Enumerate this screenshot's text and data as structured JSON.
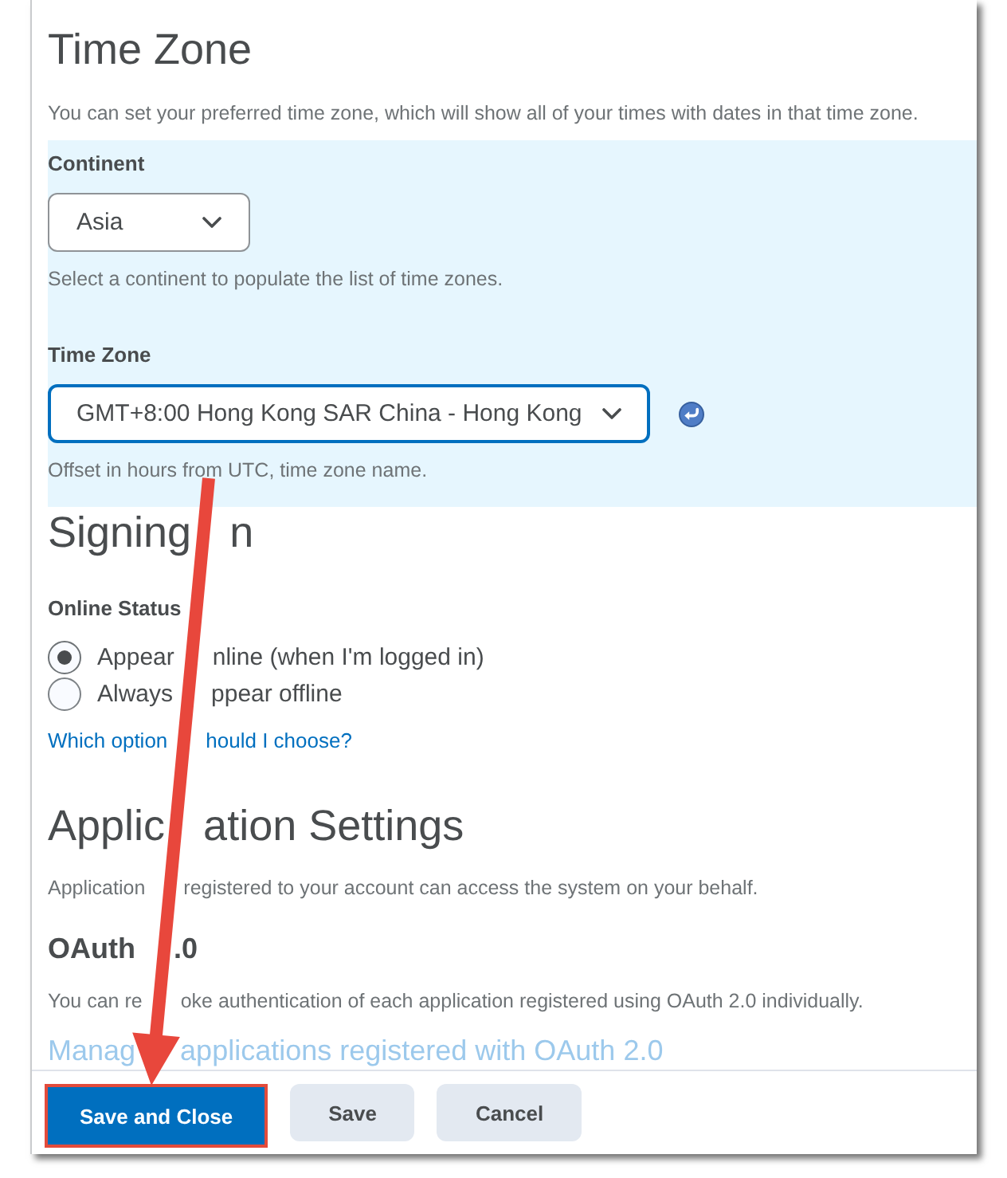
{
  "time_zone": {
    "title": "Time Zone",
    "description": "You can set your preferred time zone, which will show all of your times with dates in that time zone.",
    "continent": {
      "label": "Continent",
      "value": "Asia",
      "focused": false,
      "help": "Select a continent to populate the list of time zones."
    },
    "zone": {
      "label": "Time Zone",
      "value": "GMT+8:00 Hong Kong SAR China - Hong Kong",
      "focused": true,
      "help": "Offset in hours from UTC, time zone name."
    }
  },
  "signing_in": {
    "title": [
      "Signing",
      "n"
    ],
    "status_label": "Online Status",
    "options": [
      {
        "label": [
          "Appear",
          "nline (when I'm logged in)"
        ],
        "selected": true
      },
      {
        "label": [
          "Always",
          "ppear offline"
        ],
        "selected": false
      }
    ],
    "help_link": [
      "Which option",
      "hould I choose?"
    ]
  },
  "application_settings": {
    "title": [
      "Applic",
      "ation Settings"
    ],
    "description": [
      "Application",
      "registered to your account can access the system on your behalf."
    ],
    "oauth": {
      "title": [
        "OAuth",
        ".0"
      ],
      "description": [
        "You can re",
        "oke authentication of each application registered using OAuth 2.0 individually."
      ],
      "link": [
        "Manag",
        "applications registered with OAuth 2.0"
      ]
    }
  },
  "footer": {
    "buttons": [
      {
        "label": "Save and Close",
        "kind": "primary",
        "highlighted": true
      },
      {
        "label": "Save",
        "kind": "secondary",
        "highlighted": false
      },
      {
        "label": "Cancel",
        "kind": "secondary",
        "highlighted": false
      }
    ]
  }
}
